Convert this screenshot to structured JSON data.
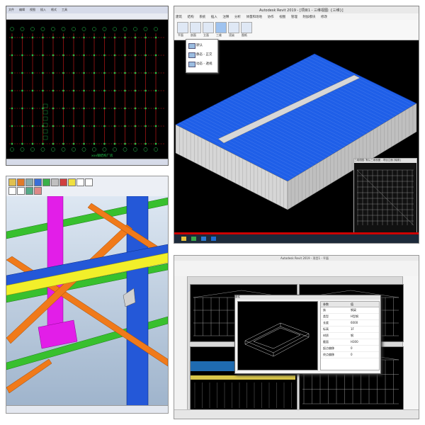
{
  "panel_cad": {
    "status_caption": "xxx钢结构厂房",
    "menu_items": [
      "文件",
      "编辑",
      "视图",
      "插入",
      "格式",
      "工具"
    ]
  },
  "panel_revit": {
    "window_title": "Autodesk Revit 2019 - [项目1 - 三维视图: {三维}]",
    "menu_items": [
      "建筑",
      "结构",
      "系统",
      "插入",
      "注释",
      "分析",
      "体量和场地",
      "协作",
      "视图",
      "管理",
      "附加模块",
      "修改"
    ],
    "ribbon_buttons": [
      "平面",
      "剖面",
      "立面",
      "三维",
      "渲染",
      "图纸"
    ],
    "dropdown_items": [
      "默认",
      "静态 - 正交",
      "动态 - 透视"
    ],
    "inset_title": "三维视图: 默认三维视图 - 项目立面 [轴测]"
  },
  "panel_tekla": {
    "toolbar_icons": [
      "save-icon",
      "open-icon",
      "print-icon",
      "beam-icon",
      "column-icon",
      "plate-icon",
      "bolt-icon",
      "weld-icon",
      "measure-icon",
      "snap-icon"
    ]
  },
  "panel_revit2": {
    "window_title": "Autodesk Revit 2019 - 项目1 - 平面",
    "dialog_title": "属性",
    "props_header": [
      "参数",
      "值"
    ],
    "props_rows": [
      [
        "族",
        "钢梁"
      ],
      [
        "类型",
        "H型钢"
      ],
      [
        "长度",
        "6000"
      ],
      [
        "标高",
        "1F"
      ],
      [
        "材质",
        "钢"
      ],
      [
        "截面",
        "H300"
      ],
      [
        "起点偏移",
        "0"
      ],
      [
        "终点偏移",
        "0"
      ]
    ]
  },
  "colors": {
    "roof_blue": "#1f5fe8",
    "cad_red": "#d21a1a",
    "cad_green": "#22c24a",
    "tekla_orange": "#f07a1a",
    "tekla_green": "#38c02e",
    "tekla_blue": "#2458d8",
    "tekla_magenta": "#e21ee8",
    "tekla_yellow": "#f2ef2a"
  }
}
